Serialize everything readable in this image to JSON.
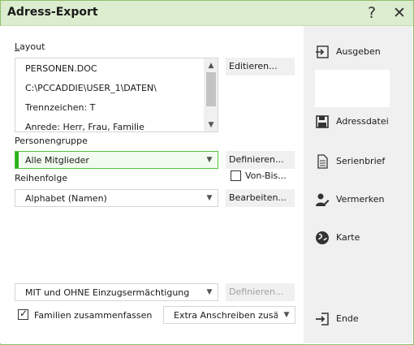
{
  "window": {
    "title": "Adress-Export",
    "help": "?",
    "close": "✕"
  },
  "layout": {
    "label": "Layout",
    "items": [
      "PERSONEN.DOC",
      "C:\\PCCADDIE\\USER_1\\DATEN\\",
      "Trennzeichen: T",
      "Anrede: Herr, Frau, Familie"
    ],
    "edit_button": "Editieren..."
  },
  "personengruppe": {
    "label": "Personengruppe",
    "value": "Alle Mitglieder",
    "define_button": "Definieren...",
    "von_bis_label": "Von-Bis..."
  },
  "reihenfolge": {
    "label": "Reihenfolge",
    "value": "Alphabet (Namen)",
    "edit_button": "Bearbeiten..."
  },
  "einzug": {
    "value": "MIT und OHNE Einzugsermächtigung",
    "define_button": "Definieren..."
  },
  "familien": {
    "label": "Familien zusammenfassen",
    "checked": true
  },
  "anschreiben": {
    "value": "Extra Anschreiben zusätzl"
  },
  "sidebar": {
    "ausgeben": "Ausgeben",
    "adressdatei": "Adressdatei",
    "serienbrief": "Serienbrief",
    "vermerken": "Vermerken",
    "karte": "Karte",
    "ende": "Ende"
  }
}
